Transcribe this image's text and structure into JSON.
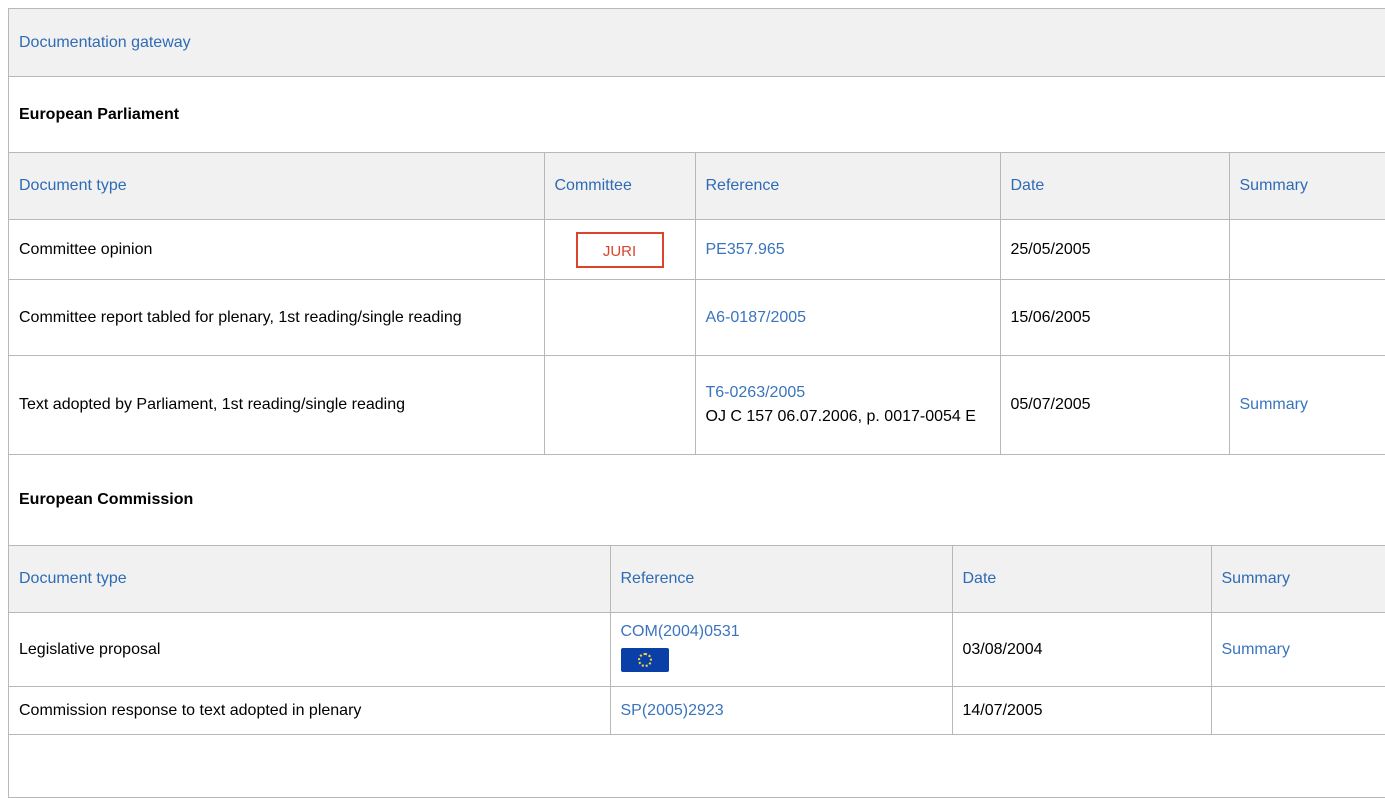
{
  "gateway": {
    "title": "Documentation gateway"
  },
  "parliament": {
    "title": "European Parliament",
    "headers": {
      "doc_type": "Document type",
      "committee": "Committee",
      "reference": "Reference",
      "date": "Date",
      "summary": "Summary"
    },
    "rows": [
      {
        "doc_type": "Committee opinion",
        "committee": "JURI",
        "reference": "PE357.965",
        "reference_extra": "",
        "date": "25/05/2005",
        "summary": ""
      },
      {
        "doc_type": "Committee report tabled for plenary, 1st reading/single reading",
        "committee": "",
        "reference": "A6-0187/2005",
        "reference_extra": "",
        "date": "15/06/2005",
        "summary": ""
      },
      {
        "doc_type": "Text adopted by Parliament, 1st reading/single reading",
        "committee": "",
        "reference": "T6-0263/2005",
        "reference_extra": "OJ C 157 06.07.2006, p. 0017-0054 E",
        "date": "05/07/2005",
        "summary": "Summary"
      }
    ]
  },
  "commission": {
    "title": "European Commission",
    "headers": {
      "doc_type": "Document type",
      "reference": "Reference",
      "date": "Date",
      "summary": "Summary"
    },
    "rows": [
      {
        "doc_type": "Legislative proposal",
        "reference": "COM(2004)0531",
        "icon": "eu-flag-icon",
        "date": "03/08/2004",
        "summary": "Summary"
      },
      {
        "doc_type": "Commission response to text adopted in plenary",
        "reference": "SP(2005)2923",
        "date": "14/07/2005",
        "summary": ""
      }
    ]
  },
  "colors": {
    "link": "#3a74bd",
    "header_bg": "#f1f1f1",
    "badge": "#d9442b",
    "border": "#b8b8b8"
  }
}
